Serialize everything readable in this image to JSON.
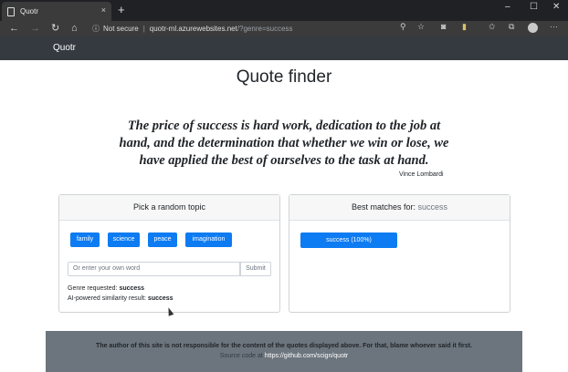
{
  "browser": {
    "tab_title": "Quotr",
    "tab_close": "×",
    "new_tab": "+",
    "security": "Not secure",
    "url_host": "quotr-ml.azurewebsites.net",
    "url_path": "/?genre=success",
    "window_controls": [
      "–",
      "☐",
      "✕"
    ]
  },
  "navbar": {
    "brand": "Quotr"
  },
  "page": {
    "title": "Quote finder",
    "quote": "The price of success is hard work, dedication to the job at hand, and the determination that whether we win or lose, we have applied the best of ourselves to the task at hand.",
    "author": "Vince Lombardi"
  },
  "topic_card": {
    "header": "Pick a random topic",
    "topics": [
      "family",
      "science",
      "peace",
      "imagination"
    ],
    "input_placeholder": "Or enter your own word",
    "submit_label": "Submit",
    "genre_label": "Genre requested: ",
    "genre_value": "success",
    "similarity_label": "AI-powered similarity result: ",
    "similarity_value": "success"
  },
  "matches_card": {
    "header_label": "Best matches for: ",
    "header_value": "success",
    "matches": [
      "success (100%)"
    ]
  },
  "footer": {
    "disclaimer": "The author of this site is not responsible for the content of the quotes displayed above. For that, blame whoever said it first.",
    "source_label": "Source code at ",
    "source_link": "https://github.com/scign/quotr"
  },
  "colors": {
    "primary": "#0d7bf2",
    "navbar": "#343a40",
    "footer": "#6c757d"
  }
}
